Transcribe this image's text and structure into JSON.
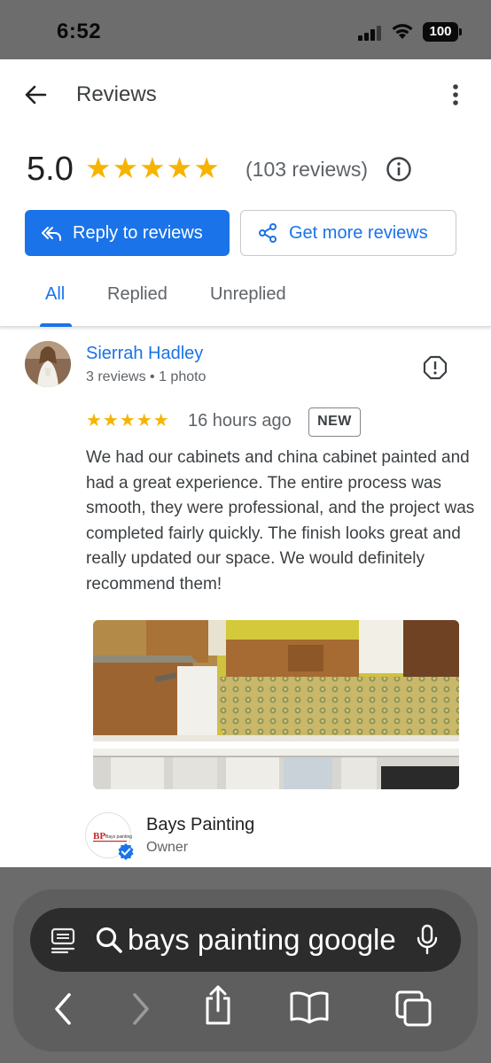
{
  "status_bar": {
    "time": "6:52",
    "battery": "100"
  },
  "header": {
    "title": "Reviews"
  },
  "summary": {
    "rating": "5.0",
    "stars": "★★★★★",
    "count": "(103 reviews)"
  },
  "actions": {
    "reply_label": "Reply to reviews",
    "get_more_label": "Get more reviews"
  },
  "tabs": [
    {
      "label": "All",
      "selected": true
    },
    {
      "label": "Replied",
      "selected": false
    },
    {
      "label": "Unreplied",
      "selected": false
    }
  ],
  "review": {
    "name": "Sierrah Hadley",
    "meta": "3 reviews • 1 photo",
    "stars": "★★★★★",
    "rating_value": 5,
    "time": "16 hours ago",
    "badge": "NEW",
    "text": "We had our cabinets and china cabinet painted and had a great experience. The entire process was smooth, they were professional, and the project was completed fairly quickly. The finish looks great and really updated our space. We would definitely recommend them!"
  },
  "owner": {
    "name": "Bays Painting",
    "role": "Owner",
    "logo_text": "Bays painting"
  },
  "browser": {
    "url_text": "bays painting google"
  },
  "colors": {
    "accent": "#1a73e8",
    "star": "#f6b400",
    "text": "#202124",
    "muted": "#5f6368"
  },
  "icons": [
    "back-arrow-icon",
    "more-vert-icon",
    "info-icon",
    "reply-all-icon",
    "share-icon",
    "report-icon",
    "verified-icon",
    "tabs-overview-icon",
    "search-icon",
    "microphone-icon",
    "browser-back-icon",
    "browser-forward-icon",
    "share-browser-icon",
    "bookmarks-icon",
    "tabs-icon"
  ]
}
